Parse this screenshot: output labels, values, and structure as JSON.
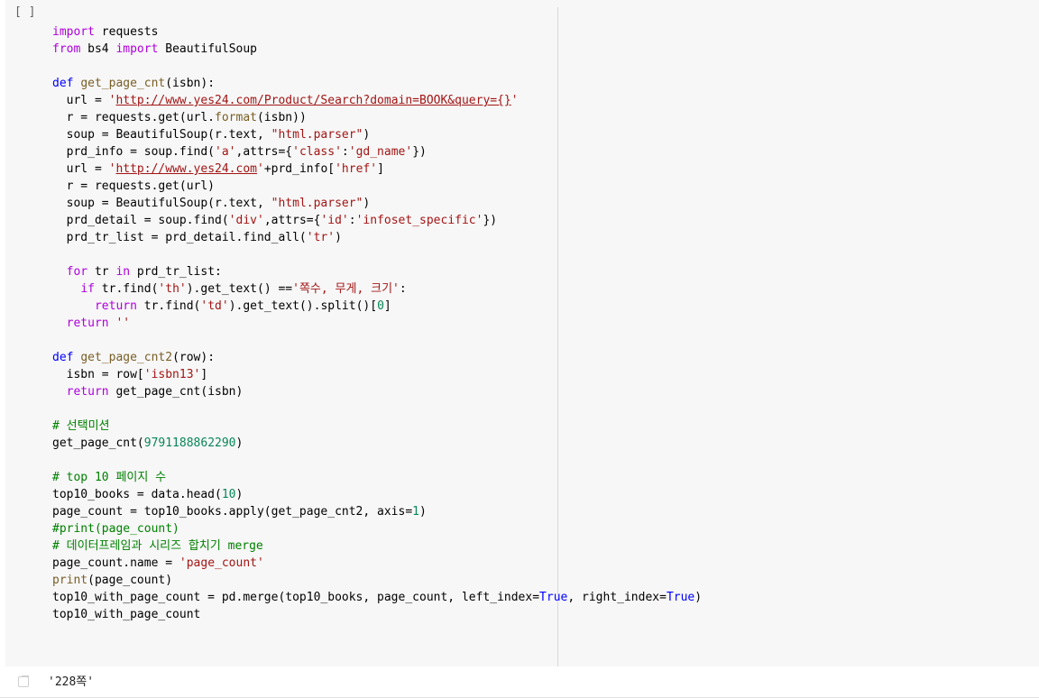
{
  "cell": {
    "run_indicator": "[ ]",
    "code_lines": [
      [
        [
          "import",
          "kw"
        ],
        [
          " requests",
          ""
        ]
      ],
      [
        [
          "from",
          "kw"
        ],
        [
          " bs4 ",
          ""
        ],
        [
          "import",
          "kw"
        ],
        [
          " BeautifulSoup",
          ""
        ]
      ],
      [],
      [
        [
          "def",
          "def"
        ],
        [
          " ",
          ""
        ],
        [
          "get_page_cnt",
          "fn"
        ],
        [
          "(isbn):",
          ""
        ]
      ],
      [
        [
          "  url = ",
          ""
        ],
        [
          "'",
          "str"
        ],
        [
          "http://www.yes24.com/Product/Search?domain=BOOK&query={}",
          "str url"
        ],
        [
          "'",
          "str"
        ]
      ],
      [
        [
          "  r = requests.get(url.",
          ""
        ],
        [
          "format",
          "fn"
        ],
        [
          "(isbn))",
          ""
        ]
      ],
      [
        [
          "  soup = BeautifulSoup(r.text, ",
          ""
        ],
        [
          "\"html.parser\"",
          "str"
        ],
        [
          ")",
          ""
        ]
      ],
      [
        [
          "  prd_info = soup.find(",
          ""
        ],
        [
          "'a'",
          "str"
        ],
        [
          ",attrs={",
          ""
        ],
        [
          "'class'",
          "str"
        ],
        [
          ":",
          ""
        ],
        [
          "'gd_name'",
          "str"
        ],
        [
          "})",
          ""
        ]
      ],
      [
        [
          "  url = ",
          ""
        ],
        [
          "'",
          "str"
        ],
        [
          "http://www.yes24.com",
          "str url"
        ],
        [
          "'",
          "str"
        ],
        [
          "+prd_info[",
          ""
        ],
        [
          "'href'",
          "str"
        ],
        [
          "]",
          ""
        ]
      ],
      [
        [
          "  r = requests.get(url)",
          ""
        ]
      ],
      [
        [
          "  soup = BeautifulSoup(r.text, ",
          ""
        ],
        [
          "\"html.parser\"",
          "str"
        ],
        [
          ")",
          ""
        ]
      ],
      [
        [
          "  prd_detail = soup.find(",
          ""
        ],
        [
          "'div'",
          "str"
        ],
        [
          ",attrs={",
          ""
        ],
        [
          "'id'",
          "str"
        ],
        [
          ":",
          ""
        ],
        [
          "'infoset_specific'",
          "str"
        ],
        [
          "})",
          ""
        ]
      ],
      [
        [
          "  prd_tr_list = prd_detail.find_all(",
          ""
        ],
        [
          "'tr'",
          "str"
        ],
        [
          ")",
          ""
        ]
      ],
      [],
      [
        [
          "  ",
          ""
        ],
        [
          "for",
          "kw"
        ],
        [
          " tr ",
          ""
        ],
        [
          "in",
          "kw"
        ],
        [
          " prd_tr_list:",
          ""
        ]
      ],
      [
        [
          "    ",
          ""
        ],
        [
          "if",
          "kw"
        ],
        [
          " tr.find(",
          ""
        ],
        [
          "'th'",
          "str"
        ],
        [
          ").get_text() ==",
          ""
        ],
        [
          "'쪽수, 무게, 크기'",
          "str"
        ],
        [
          ":",
          ""
        ]
      ],
      [
        [
          "      ",
          ""
        ],
        [
          "return",
          "kw"
        ],
        [
          " tr.find(",
          ""
        ],
        [
          "'td'",
          "str"
        ],
        [
          ").get_text().split()[",
          ""
        ],
        [
          "0",
          "num"
        ],
        [
          "]",
          ""
        ]
      ],
      [
        [
          "  ",
          ""
        ],
        [
          "return",
          "kw"
        ],
        [
          " ",
          ""
        ],
        [
          "''",
          "str"
        ]
      ],
      [],
      [
        [
          "def",
          "def"
        ],
        [
          " ",
          ""
        ],
        [
          "get_page_cnt2",
          "fn"
        ],
        [
          "(row):",
          ""
        ]
      ],
      [
        [
          "  isbn = row[",
          ""
        ],
        [
          "'isbn13'",
          "str"
        ],
        [
          "]",
          ""
        ]
      ],
      [
        [
          "  ",
          ""
        ],
        [
          "return",
          "kw"
        ],
        [
          " get_page_cnt(isbn)",
          ""
        ]
      ],
      [],
      [
        [
          "# 선택미션",
          "cm"
        ]
      ],
      [
        [
          "get_page_cnt(",
          ""
        ],
        [
          "9791188862290",
          "num"
        ],
        [
          ")",
          ""
        ]
      ],
      [],
      [
        [
          "# top 10 페이지 수",
          "cm"
        ]
      ],
      [
        [
          "top10_books = data.head(",
          ""
        ],
        [
          "10",
          "num"
        ],
        [
          ")",
          ""
        ]
      ],
      [
        [
          "page_count = top10_books.apply(get_page_cnt2, axis=",
          ""
        ],
        [
          "1",
          "num"
        ],
        [
          ")",
          ""
        ]
      ],
      [
        [
          "#print(page_count)",
          "cm"
        ]
      ],
      [
        [
          "# 데이터프레임과 시리즈 합치기 merge",
          "cm"
        ]
      ],
      [
        [
          "page_count.name = ",
          ""
        ],
        [
          "'page_count'",
          "str"
        ]
      ],
      [
        [
          "print",
          "fn"
        ],
        [
          "(page_count)",
          ""
        ]
      ],
      [
        [
          "top10_with_page_count = pd.merge(top10_books, page_count, left_index=",
          ""
        ],
        [
          "True",
          "def"
        ],
        [
          ", right_index=",
          ""
        ],
        [
          "True",
          "def"
        ],
        [
          ")",
          ""
        ]
      ],
      [
        [
          "top10_with_page_count",
          ""
        ]
      ]
    ]
  },
  "output": {
    "text": "'228쪽'"
  }
}
